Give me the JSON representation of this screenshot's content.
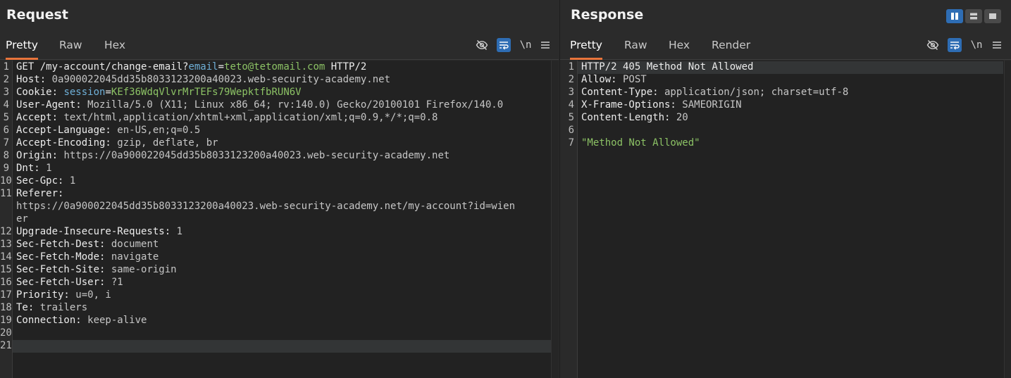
{
  "request": {
    "title": "Request",
    "tabs": [
      "Pretty",
      "Raw",
      "Hex"
    ],
    "active_tab": "Pretty",
    "icons": [
      "eye-slash-icon",
      "wrap-icon",
      "newline-icon",
      "menu-icon"
    ],
    "newline_label": "\\n",
    "line_numbers": [
      "1",
      "2",
      "3",
      "4",
      "5",
      "6",
      "7",
      "8",
      "9",
      "10",
      "11",
      "",
      "",
      "12",
      "13",
      "14",
      "15",
      "16",
      "17",
      "18",
      "19",
      "20",
      "21"
    ],
    "lines": {
      "l1_method": "GET ",
      "l1_path": "/my-account/change-email?",
      "l1_param": "email",
      "l1_eq": "=",
      "l1_value": "teto@tetomail.com",
      "l1_proto": " HTTP/2",
      "l2_k": "Host:",
      "l2_v": " 0a900022045dd35b8033123200a40023.web-security-academy.net",
      "l3_k": "Cookie:",
      "l3_name": " session",
      "l3_eq": "=",
      "l3_v": "KEf36WdqVlvrMrTEFs79WepktfbRUN6V",
      "l4_k": "User-Agent:",
      "l4_v": " Mozilla/5.0 (X11; Linux x86_64; rv:140.0) Gecko/20100101 Firefox/140.0",
      "l5_k": "Accept:",
      "l5_v": " text/html,application/xhtml+xml,application/xml;q=0.9,*/*;q=0.8",
      "l6_k": "Accept-Language:",
      "l6_v": " en-US,en;q=0.5",
      "l7_k": "Accept-Encoding:",
      "l7_v": " gzip, deflate, br",
      "l8_k": "Origin:",
      "l8_v": " https://0a900022045dd35b8033123200a40023.web-security-academy.net",
      "l9_k": "Dnt:",
      "l9_v": " 1",
      "l10_k": "Sec-Gpc:",
      "l10_v": " 1",
      "l11_k": "Referer:",
      "l11_v1": "https://0a900022045dd35b8033123200a40023.web-security-academy.net/my-account?id=wien",
      "l11_v2": "er",
      "l12_k": "Upgrade-Insecure-Requests:",
      "l12_v": " 1",
      "l13_k": "Sec-Fetch-Dest:",
      "l13_v": " document",
      "l14_k": "Sec-Fetch-Mode:",
      "l14_v": " navigate",
      "l15_k": "Sec-Fetch-Site:",
      "l15_v": " same-origin",
      "l16_k": "Sec-Fetch-User:",
      "l16_v": " ?1",
      "l17_k": "Priority:",
      "l17_v": " u=0, i",
      "l18_k": "Te:",
      "l18_v": " trailers",
      "l19_k": "Connection:",
      "l19_v": " keep-alive"
    }
  },
  "response": {
    "title": "Response",
    "tabs": [
      "Pretty",
      "Raw",
      "Hex",
      "Render"
    ],
    "active_tab": "Pretty",
    "layout_buttons": [
      "split-horizontal-icon",
      "split-vertical-icon",
      "single-pane-icon"
    ],
    "newline_label": "\\n",
    "line_numbers": [
      "1",
      "2",
      "3",
      "4",
      "5",
      "6",
      "7"
    ],
    "lines": {
      "l1": "HTTP/2 405 Method Not Allowed",
      "l2_k": "Allow:",
      "l2_v": " POST",
      "l3_k": "Content-Type:",
      "l3_v": " application/json; charset=utf-8",
      "l4_k": "X-Frame-Options:",
      "l4_v": " SAMEORIGIN",
      "l5_k": "Content-Length:",
      "l5_v": " 20",
      "l7": "\"Method Not Allowed\""
    }
  },
  "colors": {
    "accent_tab": "#e8743b",
    "toggle_on": "#2e6db4",
    "string_green": "#8cc265",
    "param_blue": "#6fb0d8"
  }
}
